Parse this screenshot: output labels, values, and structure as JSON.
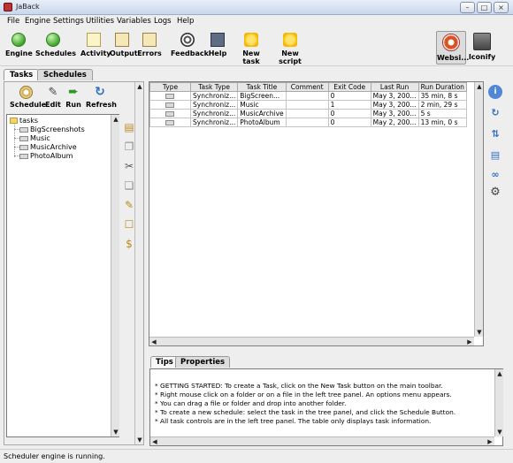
{
  "window": {
    "title": "JaBack"
  },
  "menubar": [
    "File",
    "Engine",
    "Settings",
    "Utilities",
    "Variables",
    "Logs",
    "Help"
  ],
  "toolbar": {
    "engine": "Engine",
    "schedules": "Schedules",
    "activity": "Activity",
    "output": "Output",
    "errors": "Errors",
    "feedback": "Feedback",
    "help": "Help",
    "new_task": "New task",
    "new_script": "New script",
    "website": "Websi...",
    "iconify": "Iconify"
  },
  "left_tabs": [
    "Tasks",
    "Schedules"
  ],
  "left_toolbar": {
    "schedule": "Schedule",
    "edit": "Edit",
    "run": "Run",
    "refresh": "Refresh"
  },
  "tree": {
    "root": "tasks",
    "children": [
      "BigScreenshots",
      "Music",
      "MusicArchive",
      "PhotoAlbum"
    ]
  },
  "table": {
    "columns": [
      "Type",
      "Task Type",
      "Task Title",
      "Comment",
      "Exit Code",
      "Last Run",
      "Run Duration"
    ],
    "rows": [
      [
        "",
        "Synchroniz...",
        "BigScreen...",
        "",
        "0",
        "May 3, 200...",
        "35 min, 8 s"
      ],
      [
        "",
        "Synchroniz...",
        "Music",
        "",
        "1",
        "May 3, 200...",
        "2 min, 29 s"
      ],
      [
        "",
        "Synchroniz...",
        "MusicArchive",
        "",
        "0",
        "May 3, 200...",
        "5 s"
      ],
      [
        "",
        "Synchroniz...",
        "PhotoAlbum",
        "",
        "0",
        "May 2, 200...",
        "13 min, 0 s"
      ]
    ]
  },
  "bottom_tabs": [
    "Tips",
    "Properties"
  ],
  "tips": [
    "*  GETTING STARTED: To create a Task, click on the New Task button on the main toolbar.",
    "*  Right mouse click on a folder or on a file in the left tree panel.  An options menu appears.",
    "*  You can drag a file or folder and drop into another folder.",
    "*  To create a new schedule: select the task in the tree panel, and click the Schedule Button.",
    "*  All task controls are in the left tree panel.  The table only displays task information."
  ],
  "status": "Scheduler engine is running."
}
